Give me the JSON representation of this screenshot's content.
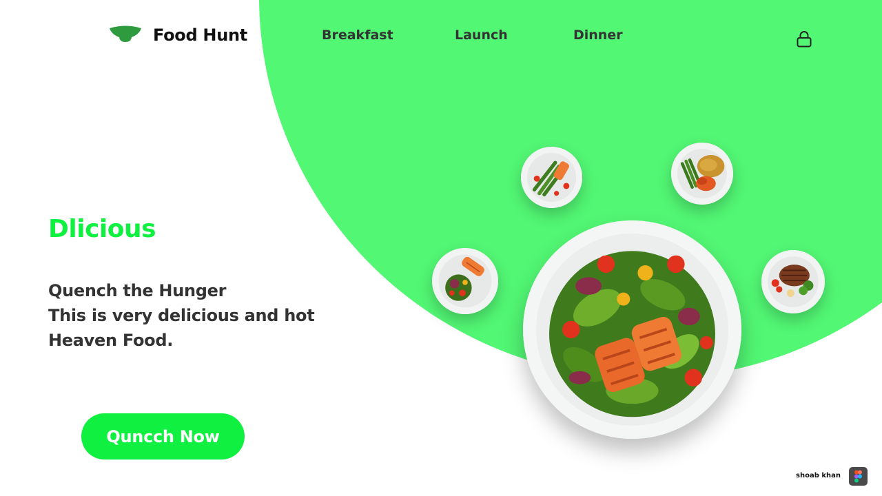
{
  "brand": {
    "name": "Food Hunt",
    "logo_icon": "bowl-icon",
    "logo_color": "#2e9b3e"
  },
  "nav": {
    "items": [
      {
        "label": "Breakfast"
      },
      {
        "label": "Launch"
      },
      {
        "label": "Dinner"
      }
    ]
  },
  "header": {
    "lock_icon": "lock-icon"
  },
  "hero": {
    "title": "Dlicious",
    "lines": [
      "Quench the Hunger",
      "This is very delicious and hot",
      "Heaven Food."
    ],
    "cta_label": "Quncch Now"
  },
  "plates": [
    {
      "name": "salmon-salad-main-plate",
      "role": "featured"
    },
    {
      "name": "asparagus-salmon-plate"
    },
    {
      "name": "green-beans-rice-plate"
    },
    {
      "name": "salmon-greens-plate"
    },
    {
      "name": "steak-broccoli-plate"
    }
  ],
  "footer": {
    "credit": "shoab khan",
    "figma_icon": "figma-icon"
  },
  "colors": {
    "accent": "#10f041",
    "blob": "#52f774",
    "text_dark": "#333333"
  }
}
